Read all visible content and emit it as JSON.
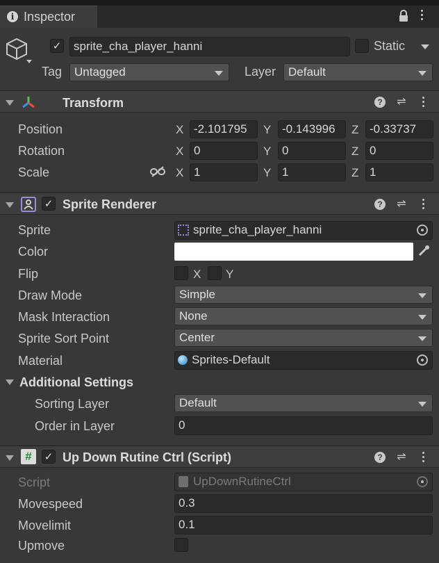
{
  "tab": {
    "title": "Inspector"
  },
  "object": {
    "name": "sprite_cha_player_hanni",
    "static_label": "Static",
    "tag_label": "Tag",
    "tag_value": "Untagged",
    "layer_label": "Layer",
    "layer_value": "Default"
  },
  "transform": {
    "title": "Transform",
    "rows": [
      {
        "label": "Position",
        "x": "-2.101795",
        "y": "-0.143996",
        "z": "-0.33737"
      },
      {
        "label": "Rotation",
        "x": "0",
        "y": "0",
        "z": "0"
      },
      {
        "label": "Scale",
        "x": "1",
        "y": "1",
        "z": "1"
      }
    ],
    "axes": [
      "X",
      "Y",
      "Z"
    ]
  },
  "sprite_renderer": {
    "title": "Sprite Renderer",
    "sprite_label": "Sprite",
    "sprite_value": "sprite_cha_player_hanni",
    "color_label": "Color",
    "color_value": "#ffffff",
    "flip_label": "Flip",
    "flip_x": "X",
    "flip_y": "Y",
    "draw_mode_label": "Draw Mode",
    "draw_mode_value": "Simple",
    "mask_label": "Mask Interaction",
    "mask_value": "None",
    "sort_point_label": "Sprite Sort Point",
    "sort_point_value": "Center",
    "material_label": "Material",
    "material_value": "Sprites-Default",
    "additional_title": "Additional Settings",
    "sorting_layer_label": "Sorting Layer",
    "sorting_layer_value": "Default",
    "order_label": "Order in Layer",
    "order_value": "0"
  },
  "script_component": {
    "title": "Up Down Rutine Ctrl (Script)",
    "script_label": "Script",
    "script_value": "UpDownRutineCtrl",
    "movespeed_label": "Movespeed",
    "movespeed_value": "0.3",
    "movelimit_label": "Movelimit",
    "movelimit_value": "0.1",
    "upmove_label": "Upmove"
  }
}
